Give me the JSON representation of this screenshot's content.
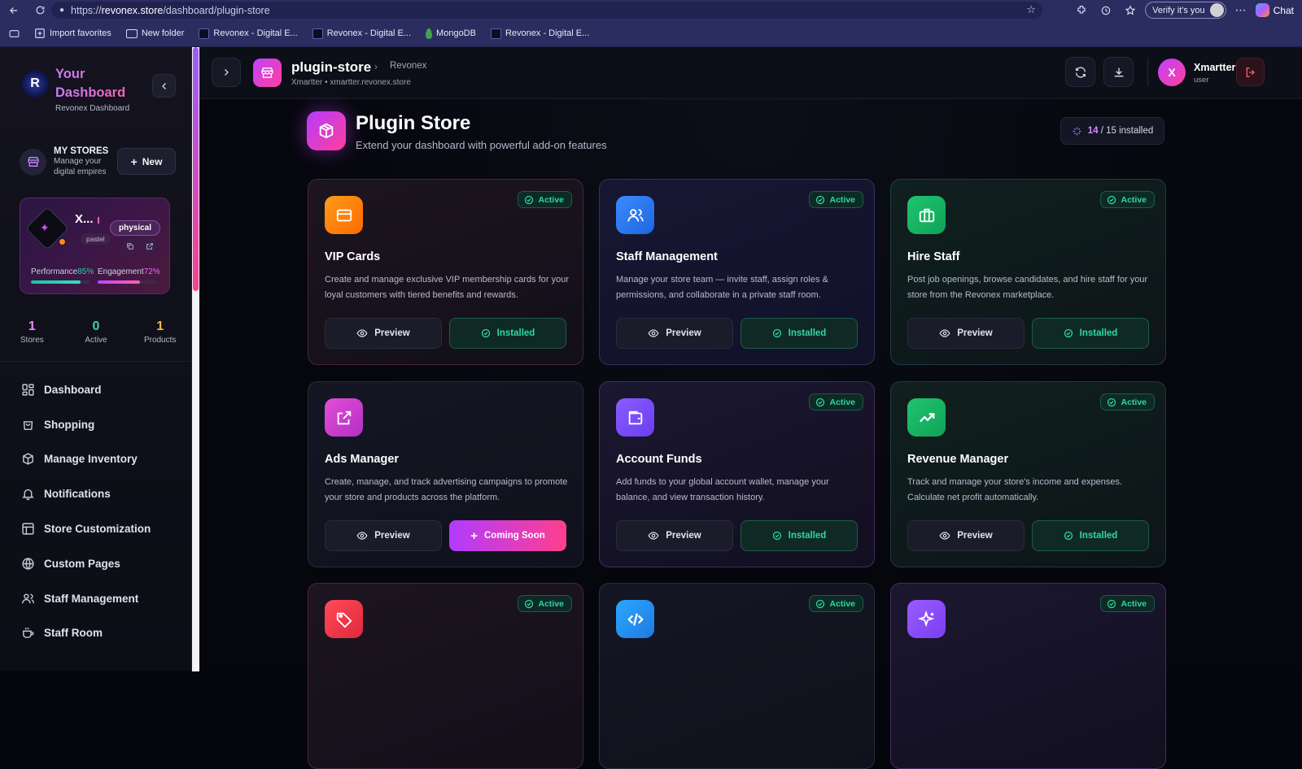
{
  "browser": {
    "url_protocol": "https://",
    "url_host": "revonex.store",
    "url_path": "/dashboard/plugin-store",
    "verify_label": "Verify it's you",
    "chat_label": "Chat",
    "bookmarks": [
      {
        "label": "Import favorites",
        "icon": "import-icon"
      },
      {
        "label": "New folder",
        "icon": "folder-icon"
      },
      {
        "label": "Revonex - Digital E...",
        "icon": "revonex-favicon"
      },
      {
        "label": "Revonex - Digital E...",
        "icon": "revonex-favicon"
      },
      {
        "label": "MongoDB",
        "icon": "mongodb-favicon"
      },
      {
        "label": "Revonex - Digital E...",
        "icon": "revonex-favicon"
      }
    ]
  },
  "sidebar": {
    "brand_title": "Your Dashboard",
    "brand_sub": "Revonex Dashboard",
    "logo_text": "R",
    "my_stores_title": "MY STORES",
    "my_stores_sub": "Manage your digital empires",
    "new_label": "New",
    "store": {
      "name": "X...",
      "type": "physical",
      "tag": "pastel",
      "performance_label": "Performance",
      "performance_value": "85%",
      "performance_fraction": 0.85,
      "engagement_label": "Engagement",
      "engagement_value": "72%",
      "engagement_fraction": 0.72
    },
    "stats": [
      {
        "value": "1",
        "label": "Stores",
        "color": "#f08bff"
      },
      {
        "value": "0",
        "label": "Active",
        "color": "#2ed8b0"
      },
      {
        "value": "1",
        "label": "Products",
        "color": "#ffb547"
      }
    ],
    "menu": [
      {
        "label": "Dashboard",
        "icon": "grid-icon"
      },
      {
        "label": "Shopping",
        "icon": "bag-icon"
      },
      {
        "label": "Manage Inventory",
        "icon": "box-icon"
      },
      {
        "label": "Notifications",
        "icon": "bell-icon"
      },
      {
        "label": "Store Customization",
        "icon": "layout-icon"
      },
      {
        "label": "Custom Pages",
        "icon": "globe-icon"
      },
      {
        "label": "Staff Management",
        "icon": "users-icon"
      },
      {
        "label": "Staff Room",
        "icon": "coffee-icon"
      }
    ]
  },
  "topbar": {
    "title": "plugin-store",
    "crumb": "Revonex",
    "sub": "Xmartter • xmartter.revonex.store",
    "user_initial": "X",
    "user_name": "Xmartter",
    "user_role": "user"
  },
  "header": {
    "title": "Plugin Store",
    "subtitle": "Extend your dashboard with powerful add-on features",
    "installed_count": "14",
    "installed_total": "/ 15 installed"
  },
  "labels": {
    "active": "Active",
    "preview": "Preview",
    "installed": "Installed",
    "coming_soon": "Coming Soon"
  },
  "colors": {
    "accent_pink": "#ff3f8e",
    "accent_purple": "#b13bff",
    "success_green": "#2ed8a3"
  },
  "plugins": [
    {
      "title": "VIP Cards",
      "desc": "Create and manage exclusive VIP membership cards for your loyal customers with tiered benefits and rewards.",
      "status": "installed",
      "active": true,
      "icon": "card-icon",
      "icon_bg": "linear-gradient(135deg,#ff9a1a,#ff6a00)",
      "theme": "pink"
    },
    {
      "title": "Staff Management",
      "desc": "Manage your store team — invite staff, assign roles & permissions, and collaborate in a private staff room.",
      "status": "installed",
      "active": true,
      "icon": "users-icon",
      "icon_bg": "linear-gradient(135deg,#3a8bff,#1f66e0)",
      "theme": "purple"
    },
    {
      "title": "Hire Staff",
      "desc": "Post job openings, browse candidates, and hire staff for your store from the Revonex marketplace.",
      "status": "installed",
      "active": true,
      "icon": "briefcase-icon",
      "icon_bg": "linear-gradient(135deg,#1fc46f,#10a357)",
      "theme": "teal"
    },
    {
      "title": "Ads Manager",
      "desc": "Create, manage, and track advertising campaigns to promote your store and products across the platform.",
      "status": "coming_soon",
      "active": false,
      "icon": "external-link-icon",
      "icon_bg": "linear-gradient(135deg,#e24fd6,#b32fc4)",
      "theme": "default"
    },
    {
      "title": "Account Funds",
      "desc": "Add funds to your global account wallet, manage your balance, and view transaction history.",
      "status": "installed",
      "active": true,
      "icon": "wallet-icon",
      "icon_bg": "linear-gradient(135deg,#8a5cff,#6a3ef0)",
      "theme": "mag"
    },
    {
      "title": "Revenue Manager",
      "desc": "Track and manage your store's income and expenses. Calculate net profit automatically.",
      "status": "installed",
      "active": true,
      "icon": "trending-up-icon",
      "icon_bg": "linear-gradient(135deg,#1fc46f,#10a357)",
      "theme": "teal"
    },
    {
      "title": "",
      "desc": "",
      "status": "",
      "active": true,
      "icon": "tag-icon",
      "icon_bg": "linear-gradient(135deg,#ff4a5a,#e0283a)",
      "theme": "pink"
    },
    {
      "title": "",
      "desc": "",
      "status": "",
      "active": true,
      "icon": "code-icon",
      "icon_bg": "linear-gradient(135deg,#29a8ff,#1f7ae0)",
      "theme": "default"
    },
    {
      "title": "",
      "desc": "",
      "status": "",
      "active": true,
      "icon": "sparkles-icon",
      "icon_bg": "linear-gradient(135deg,#9a5cff,#7a3ef0)",
      "theme": "mag"
    }
  ]
}
